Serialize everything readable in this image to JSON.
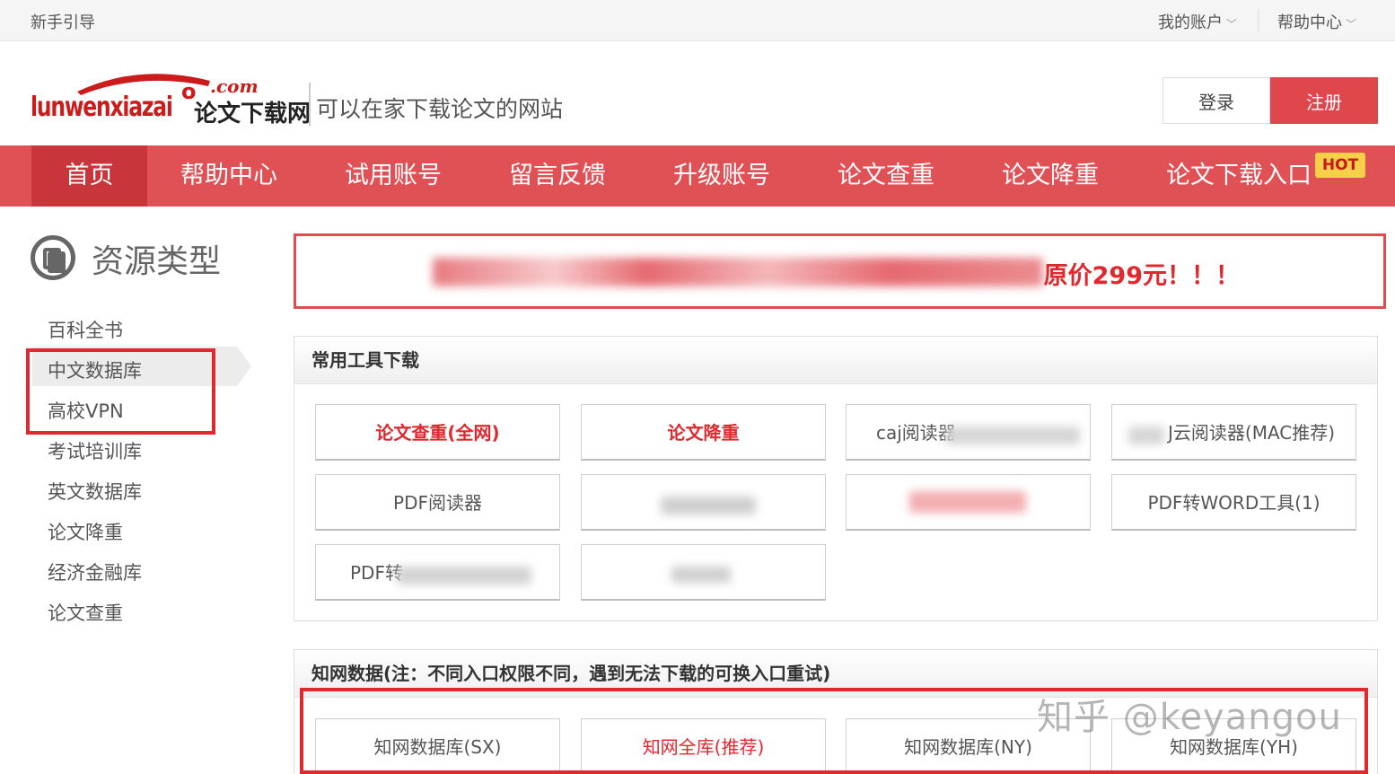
{
  "topbar": {
    "guide": "新手引导",
    "account": "我的账户",
    "help": "帮助中心"
  },
  "header": {
    "logo_com": ".com",
    "logo_name": "lunwenxiazai",
    "logo_cn": "论文下载网",
    "slogan": "可以在家下载论文的网站",
    "login": "登录",
    "register": "注册"
  },
  "nav": {
    "items": [
      "首页",
      "帮助中心",
      "试用账号",
      "留言反馈",
      "升级账号",
      "论文查重",
      "论文降重",
      "论文下载入口"
    ],
    "hot_badge": "HOT"
  },
  "sidebar": {
    "title": "资源类型",
    "items": [
      "百科全书",
      "中文数据库",
      "高校VPN",
      "考试培训库",
      "英文数据库",
      "论文降重",
      "经济金融库",
      "论文查重"
    ]
  },
  "banner": {
    "text_visible": "原价299元！！！"
  },
  "tools_panel": {
    "title": "常用工具下载",
    "buttons": [
      "论文查重(全网)",
      "论文降重",
      "caj阅读器",
      "J云阅读器(MAC推荐)",
      "PDF阅读器",
      "PDF转WORD工具(1)",
      "PDF转"
    ]
  },
  "cnki_panel": {
    "title": "知网数据(注：不同入口权限不同，遇到无法下载的可换入口重试)",
    "buttons": [
      "知网数据库(SX)",
      "知网全库(推荐)",
      "知网数据库(NY)",
      "知网数据库(YH)"
    ]
  },
  "watermark": "知乎 @keyangou",
  "colors": {
    "brand_red": "#e05156",
    "nav_active": "#c8363b",
    "highlight_red": "#e0282e",
    "hot_yellow": "#f7d04a"
  }
}
